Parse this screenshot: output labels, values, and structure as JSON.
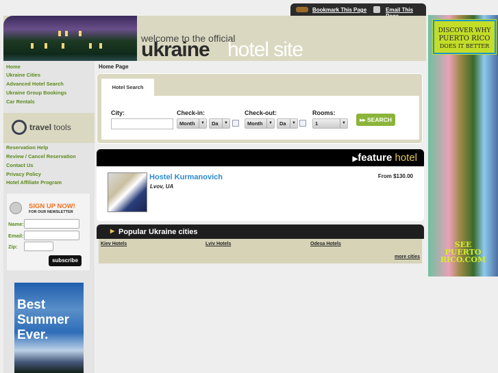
{
  "top_links": {
    "bookmark": "Bookmark This Page",
    "email": "Email This Page"
  },
  "header": {
    "welcome": "welcome to the official",
    "ukraine": "ukraine",
    "hotel_site": "hotel site"
  },
  "sidebar": {
    "nav": [
      "Home",
      "Ukraine Cities",
      "Advanced Hotel Search",
      "Ukraine Group Bookings",
      "Car Rentals"
    ],
    "travel_tools": {
      "bold": "travel",
      "light": "tools"
    },
    "tools": [
      "Reservation Help",
      "Review / Cancel Reservation",
      "Contact Us",
      "Privacy Policy",
      "Hotel Affiliate Program"
    ],
    "newsletter": {
      "headline": "SIGN UP NOW!",
      "subline": "FOR OUR NEWSLETTER",
      "name_label": "Name:",
      "email_label": "Email:",
      "zip_label": "Zip:",
      "name_value": "",
      "email_value": "",
      "zip_value": "",
      "subscribe": "subscribe"
    },
    "ad": "Best Summer Ever."
  },
  "breadcrumb": "Home Page",
  "search": {
    "tab": "Hotel Search",
    "city_label": "City:",
    "city_value": "",
    "checkin_label": "Check-in:",
    "checkout_label": "Check-out:",
    "rooms_label": "Rooms:",
    "month": "Month",
    "day": "Da",
    "rooms_value": "1",
    "button": "SEARCH"
  },
  "feature": {
    "title_bold": "feature",
    "title_light": "hotel",
    "hotel_name": "Hostel Kurmanovich",
    "location": "Lvov, UA",
    "price": "From $130.00"
  },
  "popular": {
    "title": "Popular Ukraine cities",
    "cities": [
      "Kiev Hotels",
      "Lviv Hotels",
      "Odesa Hotels"
    ],
    "more": "more cities"
  },
  "right_ad": {
    "line1": "DISCOVER WHY",
    "line2": "PUERTO RICO",
    "line3": "DOES IT BETTER",
    "footer1": "SEE",
    "footer2": "PUERTO",
    "footer3": "RICO.COM"
  },
  "colors": {
    "nav_green": "#5a8a1a",
    "beige": "#dad8c0",
    "link_blue": "#2a8ad0",
    "search_green": "#8bb53a"
  }
}
